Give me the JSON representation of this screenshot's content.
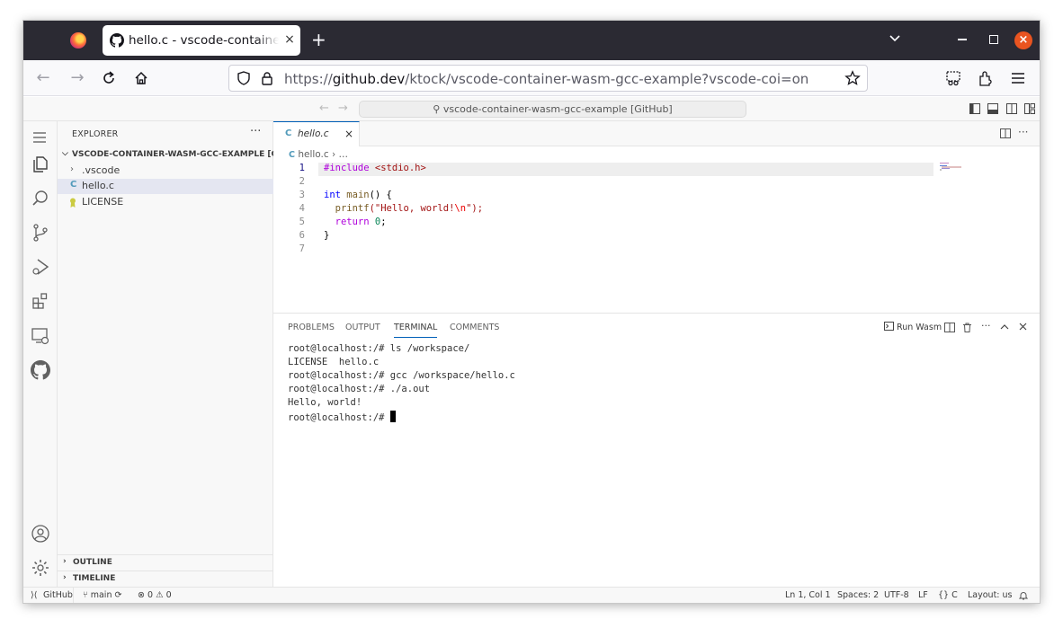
{
  "browser": {
    "tab_title": "hello.c - vscode-container-wasm-gcc-example",
    "tab_close": "×",
    "new_tab": "+",
    "url_scheme": "https://",
    "url_host": "github.dev",
    "url_path": "/ktock/vscode-container-wasm-gcc-example?vscode-coi=on",
    "close_glyph": "×"
  },
  "vscode": {
    "command_center": "vscode-container-wasm-gcc-example [GitHub]",
    "sidebar": {
      "title": "EXPLORER",
      "more": "···",
      "root": "VSCODE-CONTAINER-WASM-GCC-EXAMPLE [GITH...",
      "items": [
        {
          "label": ".vscode",
          "icon": "chevron-right-icon"
        },
        {
          "label": "hello.c",
          "icon": "c-file-icon"
        },
        {
          "label": "LICENSE",
          "icon": "license-icon"
        }
      ],
      "outline": "OUTLINE",
      "timeline": "TIMELINE"
    },
    "editor": {
      "tab_name": "hello.c",
      "tab_icon_text": "C",
      "tab_close": "×",
      "breadcrumb_file": "hello.c",
      "breadcrumb_rest": "…",
      "line_numbers": [
        "1",
        "2",
        "3",
        "4",
        "5",
        "6",
        "7"
      ],
      "lines": {
        "l1_a": "#include",
        "l1_b": "<stdio.h>",
        "l3_a": "int",
        "l3_b": "main",
        "l3_c": "() {",
        "l4_a": "  printf",
        "l4_b": "(\"Hello, world!",
        "l4_c": "\\n",
        "l4_d": "\");",
        "l5_a": "  return",
        "l5_b": "0",
        "l5_c": ";",
        "l6": "}"
      }
    },
    "panel": {
      "tabs": [
        "PROBLEMS",
        "OUTPUT",
        "TERMINAL",
        "COMMENTS"
      ],
      "active_tab": "TERMINAL",
      "run_wasm": "Run Wasm",
      "more": "···",
      "terminal_lines": [
        "root@localhost:/# ls /workspace/",
        "LICENSE  hello.c",
        "root@localhost:/# gcc /workspace/hello.c",
        "root@localhost:/# ./a.out",
        "Hello, world!",
        "root@localhost:/# "
      ]
    },
    "status": {
      "remote": "GitHub",
      "branch": "main",
      "errors": "0",
      "warnings": "0",
      "position": "Ln 1, Col 1",
      "spaces": "Spaces: 2",
      "encoding": "UTF-8",
      "eol": "LF",
      "language": "C",
      "layout": "Layout: us"
    }
  },
  "colors": {
    "accent": "#005fb8",
    "firefox_dark": "#2b2a33",
    "close_orange": "#e95420"
  }
}
